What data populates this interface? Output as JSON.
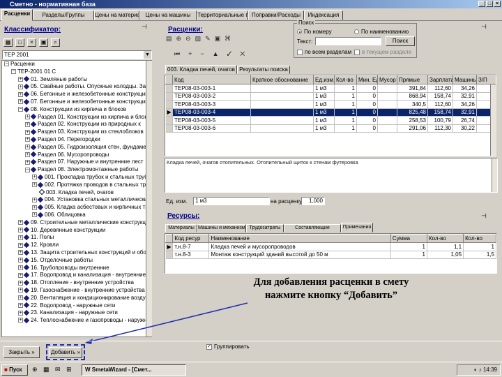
{
  "window": {
    "title": "Сметно - нормативная база"
  },
  "main_tabs": [
    "Расценки",
    "Разделы/Группы",
    "Цены на материалы",
    "Цены на машины",
    "Территориальные пояса",
    "Поправки/Расходы",
    "Индексация"
  ],
  "classifier": {
    "header": "Классификатор:",
    "combo_value": "ТЕР 2001",
    "tree": [
      {
        "t": "Расценки",
        "lvl": 0,
        "exp": "-",
        "icon": "none"
      },
      {
        "t": "ТЕР-2001 01 С",
        "lvl": 1,
        "exp": "-",
        "icon": "none"
      },
      {
        "t": "01. Земляные работы",
        "lvl": 2,
        "exp": "+",
        "icon": "d"
      },
      {
        "t": "05. Свайные работы. Опускные колодцы. Зак",
        "lvl": 2,
        "exp": "+",
        "icon": "d"
      },
      {
        "t": "06. Бетонные и железобетонные конструкции",
        "lvl": 2,
        "exp": "+",
        "icon": "d"
      },
      {
        "t": "07. Бетонные и железобетонные конструкции",
        "lvl": 2,
        "exp": "+",
        "icon": "d"
      },
      {
        "t": "08. Конструкции из кирпича и блоков",
        "lvl": 2,
        "exp": "-",
        "icon": "d"
      },
      {
        "t": "Раздел 01. Конструкции из кирпича и блоков",
        "lvl": 3,
        "exp": "+",
        "icon": "d"
      },
      {
        "t": "Раздел 02. Конструкции из природных к",
        "lvl": 3,
        "exp": "+",
        "icon": "d"
      },
      {
        "t": "Раздел 03. Конструкции из стеклоблоков",
        "lvl": 3,
        "exp": "+",
        "icon": "d"
      },
      {
        "t": "Раздел 04. Перегородки",
        "lvl": 3,
        "exp": "+",
        "icon": "d"
      },
      {
        "t": "Раздел 05. Гидроизоляция стен, фундамен",
        "lvl": 3,
        "exp": "+",
        "icon": "d"
      },
      {
        "t": "Раздел 06. Мусоропроводы",
        "lvl": 3,
        "exp": "+",
        "icon": "d"
      },
      {
        "t": "Раздел 07. Наружные и внутренние лест",
        "lvl": 3,
        "exp": "+",
        "icon": "d"
      },
      {
        "t": "Раздел 08. Электромонтажные работы",
        "lvl": 3,
        "exp": "-",
        "icon": "d"
      },
      {
        "t": "001. Прокладка трубок и стальных труб",
        "lvl": 4,
        "exp": "+",
        "icon": "d"
      },
      {
        "t": "002. Протяжка проводов в стальных труб",
        "lvl": 4,
        "exp": "+",
        "icon": "d"
      },
      {
        "t": "003. Кладка печей, очагов",
        "lvl": 4,
        "exp": "",
        "icon": "o"
      },
      {
        "t": "004. Установка стальных металлических",
        "lvl": 4,
        "exp": "+",
        "icon": "d"
      },
      {
        "t": "005. Кладка асбестовых и кирпичных труб",
        "lvl": 4,
        "exp": "+",
        "icon": "d"
      },
      {
        "t": "006. Облицовка",
        "lvl": 4,
        "exp": "+",
        "icon": "d"
      },
      {
        "t": "09. Строительные металлические конструкции",
        "lvl": 2,
        "exp": "+",
        "icon": "d"
      },
      {
        "t": "10. Деревянные конструкции",
        "lvl": 2,
        "exp": "+",
        "icon": "d"
      },
      {
        "t": "11. Полы",
        "lvl": 2,
        "exp": "+",
        "icon": "d"
      },
      {
        "t": "12. Кровли",
        "lvl": 2,
        "exp": "+",
        "icon": "d"
      },
      {
        "t": "13. Защита строительных конструкций и обору",
        "lvl": 2,
        "exp": "+",
        "icon": "d"
      },
      {
        "t": "15. Отделочные работы",
        "lvl": 2,
        "exp": "+",
        "icon": "d"
      },
      {
        "t": "16. Трубопроводы внутренние",
        "lvl": 2,
        "exp": "+",
        "icon": "d"
      },
      {
        "t": "17. Водопровод и канализация - внутренние",
        "lvl": 2,
        "exp": "+",
        "icon": "d"
      },
      {
        "t": "18. Отопление - внутренние устройства",
        "lvl": 2,
        "exp": "+",
        "icon": "d"
      },
      {
        "t": "19. Газоснабжение - внутренние устройства",
        "lvl": 2,
        "exp": "+",
        "icon": "d"
      },
      {
        "t": "20. Вентиляция и кондиционирование воздуха",
        "lvl": 2,
        "exp": "+",
        "icon": "d"
      },
      {
        "t": "22. Водопровод - наружные сети",
        "lvl": 2,
        "exp": "+",
        "icon": "d"
      },
      {
        "t": "23. Канализация - наружные сети",
        "lvl": 2,
        "exp": "+",
        "icon": "d"
      },
      {
        "t": "24. Теплоснабжение и газопроводы - наружные",
        "lvl": 2,
        "exp": "+",
        "icon": "d"
      }
    ]
  },
  "pricings": {
    "header": "Расценки:",
    "tabs": [
      "003. Кладка печей, очагов",
      "Результаты поиска"
    ],
    "columns": [
      "",
      "Код",
      "Краткое обоснование",
      "Ед.изм.",
      "Кол-во",
      "Мин. Ед.мы",
      "Мусор",
      "Прямые",
      "Зарплата",
      "Машины",
      "З/П"
    ],
    "rows": [
      {
        "code": "ТЕР08-03-003-1",
        "unit": "1 м3",
        "q": "1",
        "z": "0",
        "direct": "391,84",
        "sal": "112,60",
        "mach": "34,26",
        "zp": ""
      },
      {
        "code": "ТЕР08-03-003-2",
        "unit": "1 м3",
        "q": "1",
        "z": "0",
        "direct": "868,94",
        "sal": "158,74",
        "mach": "32,91",
        "zp": ""
      },
      {
        "code": "ТЕР08-03-003-3",
        "unit": "1 м3",
        "q": "1",
        "z": "0",
        "direct": "340,5",
        "sal": "112,60",
        "mach": "34,26",
        "zp": ""
      },
      {
        "code": "ТЕР08-03-003-4",
        "unit": "1 м3",
        "q": "1",
        "z": "0",
        "direct": "825,48",
        "sal": "158,74",
        "mach": "32,91",
        "zp": ""
      },
      {
        "code": "ТЕР08-03-003-5",
        "unit": "1 м3",
        "q": "1",
        "z": "0",
        "direct": "258,53",
        "sal": "100,79",
        "mach": "26,74",
        "zp": ""
      },
      {
        "code": "ТЕР08-03-003-6",
        "unit": "1 м3",
        "q": "1",
        "z": "0",
        "direct": "291,06",
        "sal": "112,30",
        "mach": "30,22",
        "zp": ""
      }
    ],
    "description": "Кладка печей, очагов отопительных. Отопительный щиток к стенам футеровка",
    "unit_label": "Ед. изм.",
    "unit_value": "1 м3",
    "per_label": "на расценку",
    "per_value": "1,000"
  },
  "search": {
    "group_title": "Поиск",
    "opt1": "По номеру",
    "opt2": "По наименованию",
    "text_label": "Текст:",
    "search_btn": "Поиск",
    "chk1": "по всем разделам",
    "chk2": "в текущем разделе"
  },
  "resources": {
    "header": "Ресурсы:",
    "tabs": [
      "Материалы",
      "Машины и механизмы",
      "Трудозатраты",
      "Составляющие",
      "Примечания"
    ],
    "columns": [
      "",
      "Код ресур",
      "Наименование",
      "Сумма",
      "Кол-во",
      "Кол-во"
    ],
    "rows": [
      {
        "code": "т.н.8-7",
        "name": "Кладка печей и мусоропроводов",
        "sum": "1",
        "q1": "1,1",
        "q2": "1"
      },
      {
        "code": "т.н.8-3",
        "name": "Монтаж конструкций зданий высотой до 50 м",
        "sum": "1",
        "q1": "1,05",
        "q2": "1,5"
      }
    ]
  },
  "callout": {
    "line1": "Для добавления расценки в смету",
    "line2": "нажмите кнопку “Добавить”"
  },
  "bottom": {
    "back_btn": "Закрыть",
    "add_btn": "Добавить",
    "grouping": "Группировать"
  },
  "taskbar": {
    "start": "Пуск",
    "task": "SmetaWizard - [Смет...",
    "clock": "14:39"
  }
}
